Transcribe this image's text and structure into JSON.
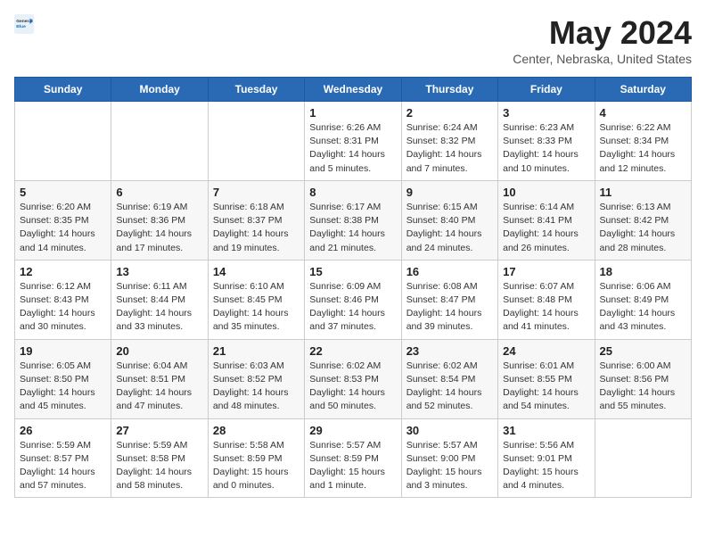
{
  "header": {
    "logo_general": "General",
    "logo_blue": "Blue",
    "month_title": "May 2024",
    "location": "Center, Nebraska, United States"
  },
  "weekdays": [
    "Sunday",
    "Monday",
    "Tuesday",
    "Wednesday",
    "Thursday",
    "Friday",
    "Saturday"
  ],
  "weeks": [
    [
      {
        "day": "",
        "info": ""
      },
      {
        "day": "",
        "info": ""
      },
      {
        "day": "",
        "info": ""
      },
      {
        "day": "1",
        "info": "Sunrise: 6:26 AM\nSunset: 8:31 PM\nDaylight: 14 hours\nand 5 minutes."
      },
      {
        "day": "2",
        "info": "Sunrise: 6:24 AM\nSunset: 8:32 PM\nDaylight: 14 hours\nand 7 minutes."
      },
      {
        "day": "3",
        "info": "Sunrise: 6:23 AM\nSunset: 8:33 PM\nDaylight: 14 hours\nand 10 minutes."
      },
      {
        "day": "4",
        "info": "Sunrise: 6:22 AM\nSunset: 8:34 PM\nDaylight: 14 hours\nand 12 minutes."
      }
    ],
    [
      {
        "day": "5",
        "info": "Sunrise: 6:20 AM\nSunset: 8:35 PM\nDaylight: 14 hours\nand 14 minutes."
      },
      {
        "day": "6",
        "info": "Sunrise: 6:19 AM\nSunset: 8:36 PM\nDaylight: 14 hours\nand 17 minutes."
      },
      {
        "day": "7",
        "info": "Sunrise: 6:18 AM\nSunset: 8:37 PM\nDaylight: 14 hours\nand 19 minutes."
      },
      {
        "day": "8",
        "info": "Sunrise: 6:17 AM\nSunset: 8:38 PM\nDaylight: 14 hours\nand 21 minutes."
      },
      {
        "day": "9",
        "info": "Sunrise: 6:15 AM\nSunset: 8:40 PM\nDaylight: 14 hours\nand 24 minutes."
      },
      {
        "day": "10",
        "info": "Sunrise: 6:14 AM\nSunset: 8:41 PM\nDaylight: 14 hours\nand 26 minutes."
      },
      {
        "day": "11",
        "info": "Sunrise: 6:13 AM\nSunset: 8:42 PM\nDaylight: 14 hours\nand 28 minutes."
      }
    ],
    [
      {
        "day": "12",
        "info": "Sunrise: 6:12 AM\nSunset: 8:43 PM\nDaylight: 14 hours\nand 30 minutes."
      },
      {
        "day": "13",
        "info": "Sunrise: 6:11 AM\nSunset: 8:44 PM\nDaylight: 14 hours\nand 33 minutes."
      },
      {
        "day": "14",
        "info": "Sunrise: 6:10 AM\nSunset: 8:45 PM\nDaylight: 14 hours\nand 35 minutes."
      },
      {
        "day": "15",
        "info": "Sunrise: 6:09 AM\nSunset: 8:46 PM\nDaylight: 14 hours\nand 37 minutes."
      },
      {
        "day": "16",
        "info": "Sunrise: 6:08 AM\nSunset: 8:47 PM\nDaylight: 14 hours\nand 39 minutes."
      },
      {
        "day": "17",
        "info": "Sunrise: 6:07 AM\nSunset: 8:48 PM\nDaylight: 14 hours\nand 41 minutes."
      },
      {
        "day": "18",
        "info": "Sunrise: 6:06 AM\nSunset: 8:49 PM\nDaylight: 14 hours\nand 43 minutes."
      }
    ],
    [
      {
        "day": "19",
        "info": "Sunrise: 6:05 AM\nSunset: 8:50 PM\nDaylight: 14 hours\nand 45 minutes."
      },
      {
        "day": "20",
        "info": "Sunrise: 6:04 AM\nSunset: 8:51 PM\nDaylight: 14 hours\nand 47 minutes."
      },
      {
        "day": "21",
        "info": "Sunrise: 6:03 AM\nSunset: 8:52 PM\nDaylight: 14 hours\nand 48 minutes."
      },
      {
        "day": "22",
        "info": "Sunrise: 6:02 AM\nSunset: 8:53 PM\nDaylight: 14 hours\nand 50 minutes."
      },
      {
        "day": "23",
        "info": "Sunrise: 6:02 AM\nSunset: 8:54 PM\nDaylight: 14 hours\nand 52 minutes."
      },
      {
        "day": "24",
        "info": "Sunrise: 6:01 AM\nSunset: 8:55 PM\nDaylight: 14 hours\nand 54 minutes."
      },
      {
        "day": "25",
        "info": "Sunrise: 6:00 AM\nSunset: 8:56 PM\nDaylight: 14 hours\nand 55 minutes."
      }
    ],
    [
      {
        "day": "26",
        "info": "Sunrise: 5:59 AM\nSunset: 8:57 PM\nDaylight: 14 hours\nand 57 minutes."
      },
      {
        "day": "27",
        "info": "Sunrise: 5:59 AM\nSunset: 8:58 PM\nDaylight: 14 hours\nand 58 minutes."
      },
      {
        "day": "28",
        "info": "Sunrise: 5:58 AM\nSunset: 8:59 PM\nDaylight: 15 hours\nand 0 minutes."
      },
      {
        "day": "29",
        "info": "Sunrise: 5:57 AM\nSunset: 8:59 PM\nDaylight: 15 hours\nand 1 minute."
      },
      {
        "day": "30",
        "info": "Sunrise: 5:57 AM\nSunset: 9:00 PM\nDaylight: 15 hours\nand 3 minutes."
      },
      {
        "day": "31",
        "info": "Sunrise: 5:56 AM\nSunset: 9:01 PM\nDaylight: 15 hours\nand 4 minutes."
      },
      {
        "day": "",
        "info": ""
      }
    ]
  ]
}
